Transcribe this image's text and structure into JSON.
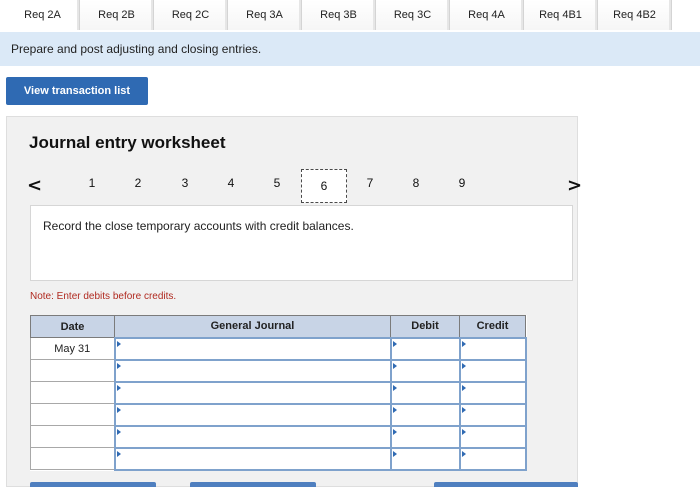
{
  "tabs": [
    "Req 2A",
    "Req 2B",
    "Req 2C",
    "Req 3A",
    "Req 3B",
    "Req 3C",
    "Req 4A",
    "Req 4B1",
    "Req 4B2"
  ],
  "active_tab": "Req 2A",
  "instruction": "Prepare and post adjusting and closing entries.",
  "view_button": "View transaction list",
  "worksheet": {
    "title": "Journal entry worksheet",
    "prev_glyph": "<",
    "next_glyph": ">",
    "pages": [
      "1",
      "2",
      "3",
      "4",
      "5",
      "6",
      "7",
      "8",
      "9"
    ],
    "selected_page": "6",
    "record_text": "Record the close temporary accounts with credit balances.",
    "note": "Note: Enter debits before credits."
  },
  "journal": {
    "headers": {
      "date": "Date",
      "account": "General Journal",
      "debit": "Debit",
      "credit": "Credit"
    },
    "rows": [
      {
        "date": "May 31",
        "account": "",
        "debit": "",
        "credit": ""
      },
      {
        "date": "",
        "account": "",
        "debit": "",
        "credit": ""
      },
      {
        "date": "",
        "account": "",
        "debit": "",
        "credit": ""
      },
      {
        "date": "",
        "account": "",
        "debit": "",
        "credit": ""
      },
      {
        "date": "",
        "account": "",
        "debit": "",
        "credit": ""
      },
      {
        "date": "",
        "account": "",
        "debit": "",
        "credit": ""
      }
    ]
  },
  "colors": {
    "accent": "#2f6ab3",
    "banner": "#dbe9f7",
    "header": "#c8d4e6",
    "note": "#b02a20"
  }
}
